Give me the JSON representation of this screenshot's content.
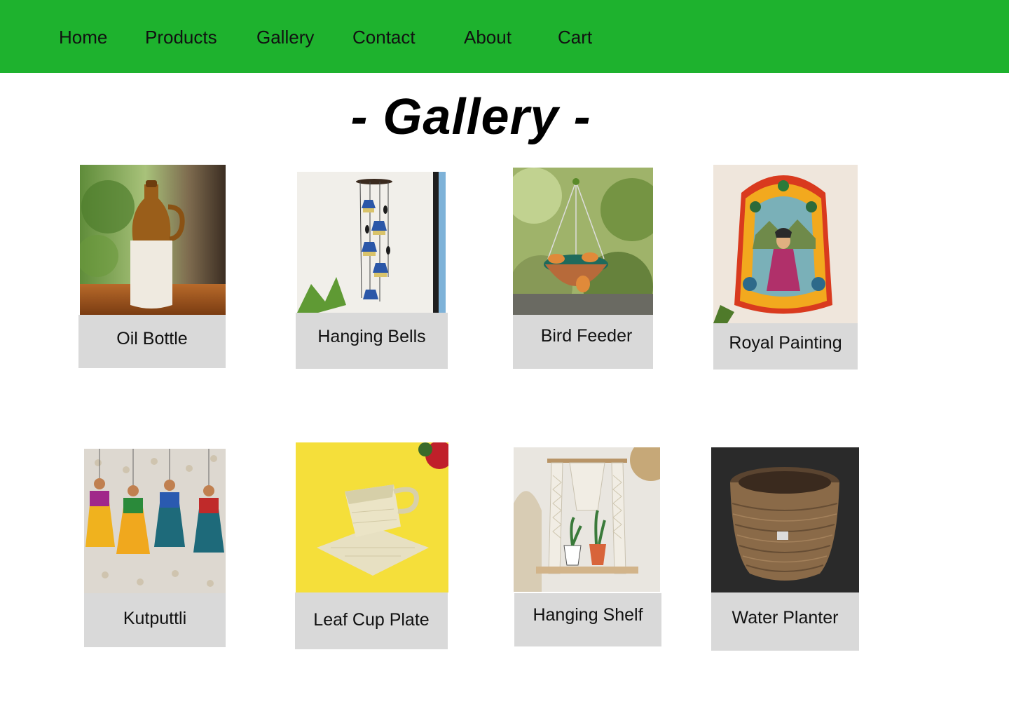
{
  "nav": {
    "items": [
      {
        "label": "Home"
      },
      {
        "label": "Products"
      },
      {
        "label": "Gallery"
      },
      {
        "label": "Contact"
      },
      {
        "label": "About"
      },
      {
        "label": "Cart"
      }
    ]
  },
  "page": {
    "title": "- Gallery -"
  },
  "gallery": {
    "items": [
      {
        "label": "Oil Bottle",
        "image": "ceramic-oil-bottle-photo"
      },
      {
        "label": "Hanging Bells",
        "image": "hanging-bells-photo"
      },
      {
        "label": "Bird Feeder",
        "image": "bird-feeder-photo"
      },
      {
        "label": "Royal Painting",
        "image": "royal-painting-photo"
      },
      {
        "label": "Kutputtli",
        "image": "kutputtli-puppets-photo"
      },
      {
        "label": "Leaf Cup Plate",
        "image": "leaf-cup-plate-photo"
      },
      {
        "label": "Hanging Shelf",
        "image": "macrame-hanging-shelf-photo"
      },
      {
        "label": "Water Planter",
        "image": "woven-water-planter-photo"
      }
    ]
  },
  "colors": {
    "navbar": "#1eb22e",
    "caption_bg": "#d9d9d9",
    "background": "#ffffff"
  }
}
